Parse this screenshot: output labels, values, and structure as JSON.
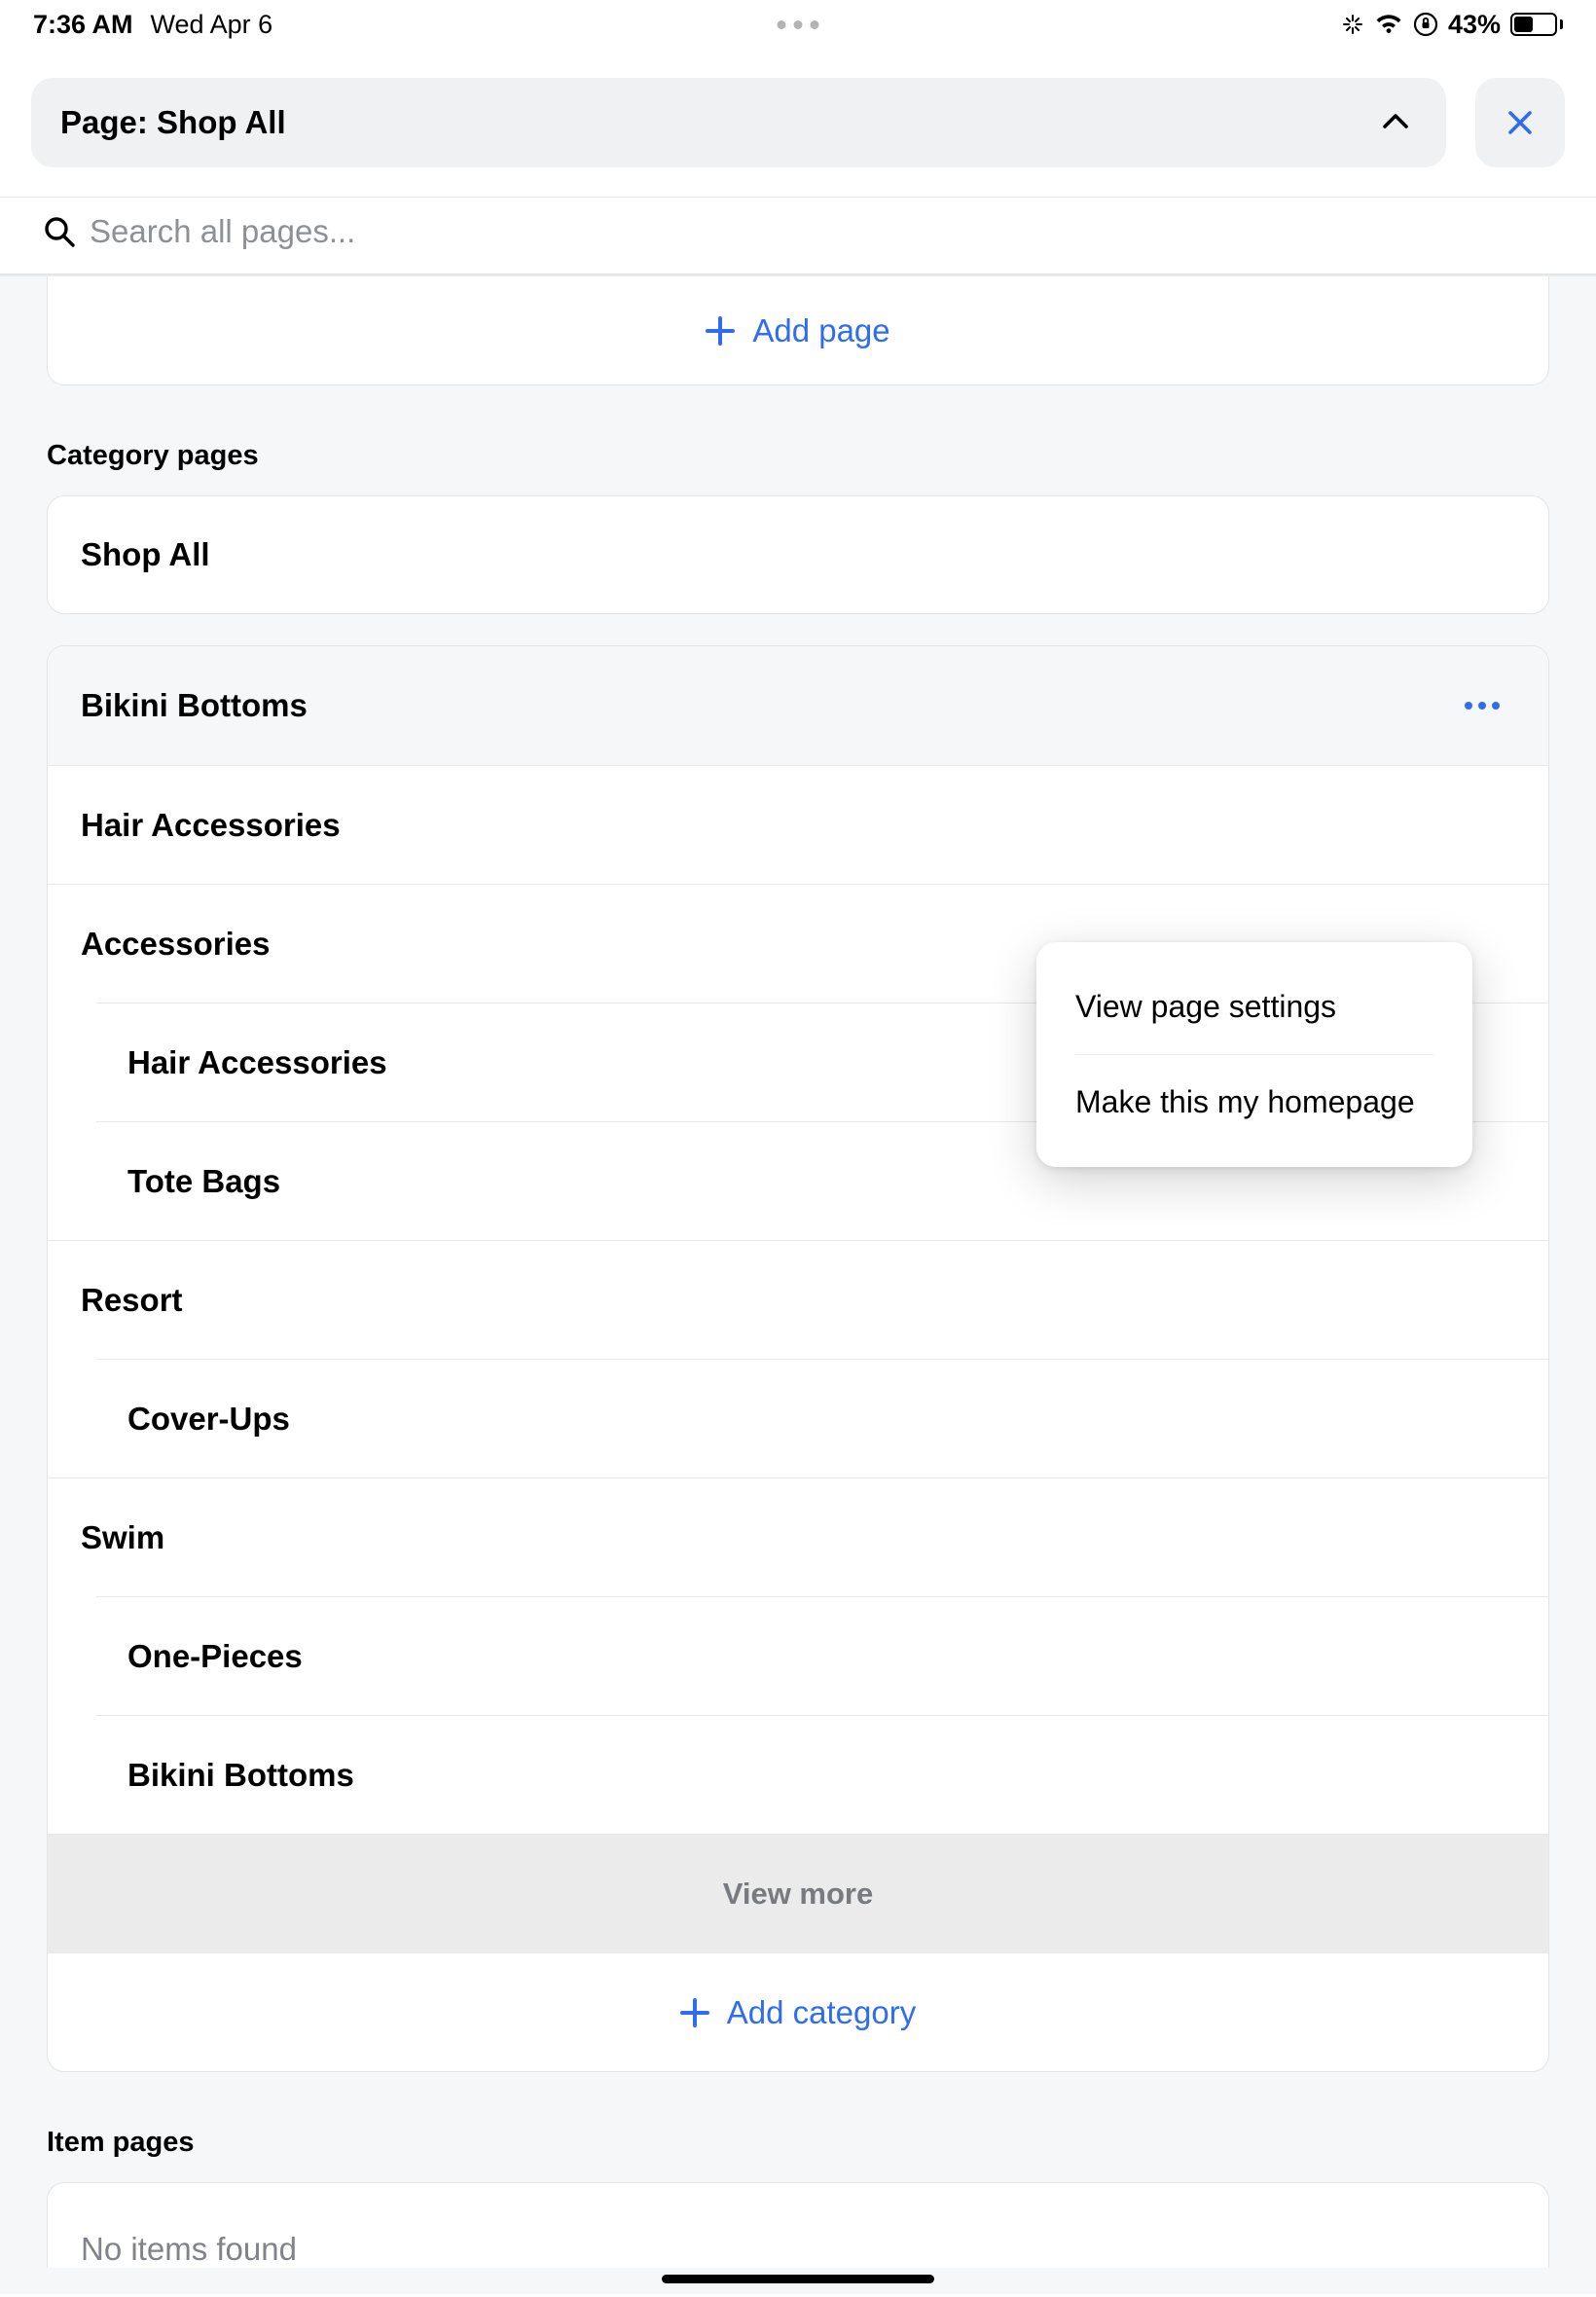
{
  "status": {
    "time": "7:36 AM",
    "date": "Wed Apr 6",
    "battery_pct": "43%"
  },
  "header": {
    "page_label": "Page: Shop All"
  },
  "search": {
    "placeholder": "Search all pages..."
  },
  "add_page_label": "Add page",
  "sections": {
    "category_label": "Category pages",
    "item_label": "Item pages"
  },
  "shop_all_label": "Shop All",
  "categories": [
    {
      "label": "Bikini Bottoms",
      "sub": false,
      "active": true,
      "has_more": true
    },
    {
      "label": "Hair Accessories",
      "sub": false
    },
    {
      "label": "Accessories",
      "sub": false
    },
    {
      "label": "Hair Accessories",
      "sub": true
    },
    {
      "label": "Tote Bags",
      "sub": true
    },
    {
      "label": "Resort",
      "sub": false
    },
    {
      "label": "Cover-Ups",
      "sub": true
    },
    {
      "label": "Swim",
      "sub": false
    },
    {
      "label": "One-Pieces",
      "sub": true
    },
    {
      "label": "Bikini Bottoms",
      "sub": true
    }
  ],
  "view_more_label": "View more",
  "add_category_label": "Add category",
  "item_pages_empty": "No items found",
  "popover": {
    "settings": "View page settings",
    "homepage": "Make this my homepage"
  }
}
